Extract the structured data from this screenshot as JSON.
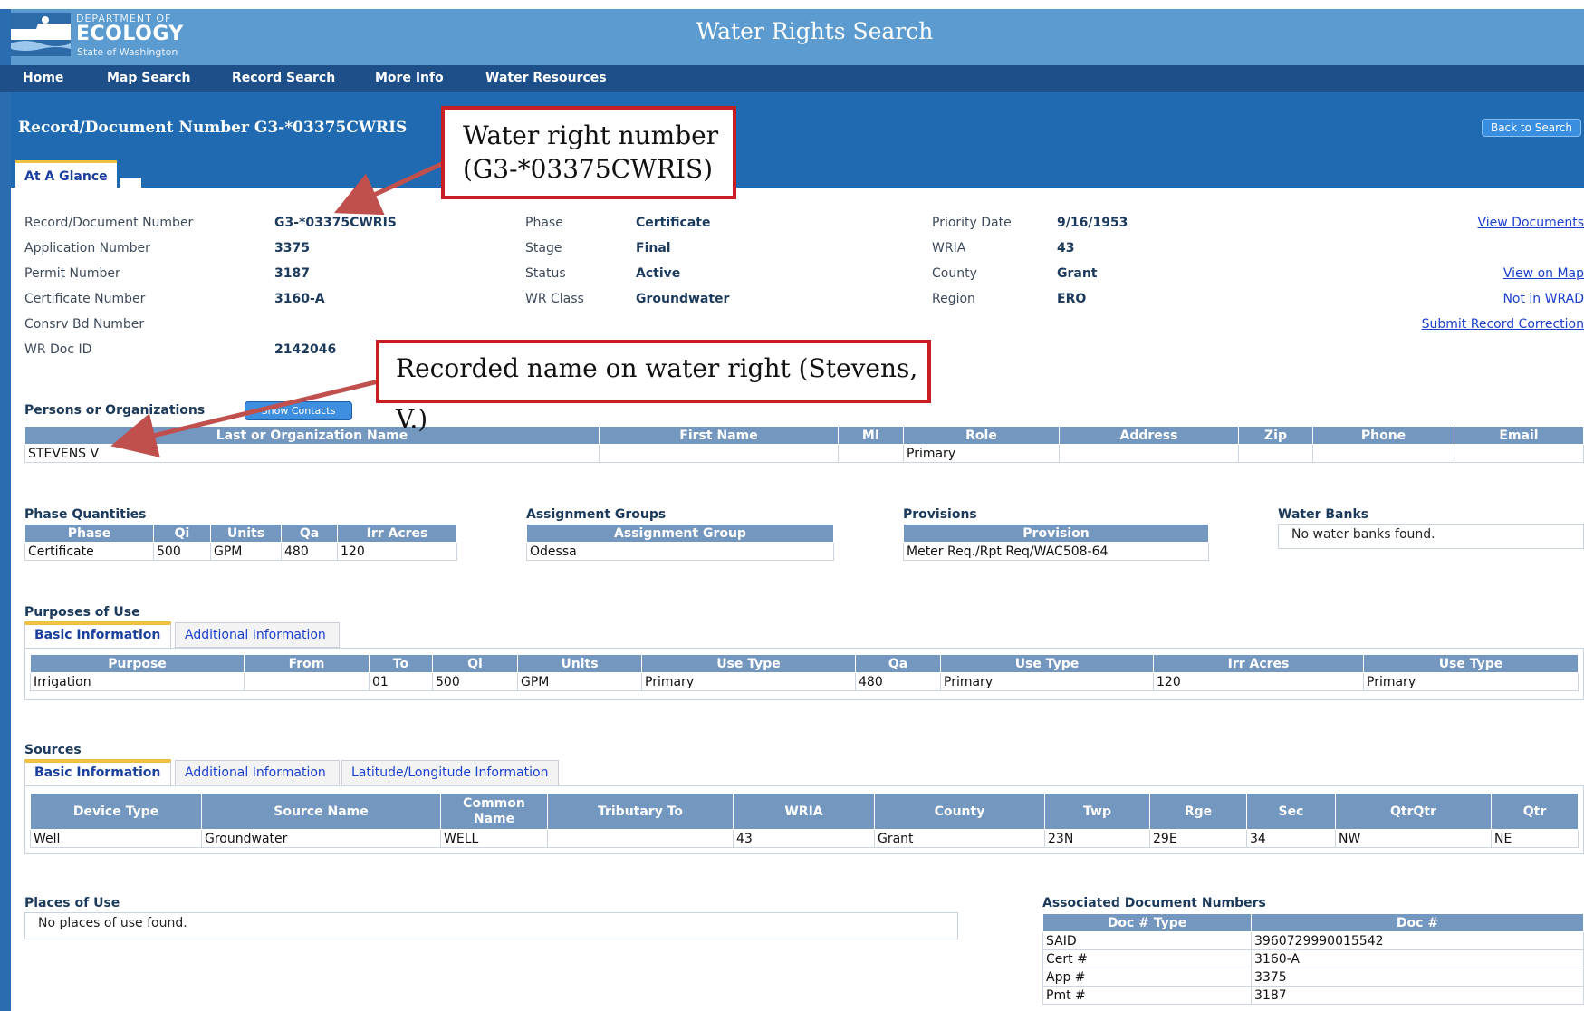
{
  "header": {
    "logo_line1": "DEPARTMENT OF",
    "logo_line2": "ECOLOGY",
    "logo_line3": "State of Washington",
    "title": "Water Rights Search"
  },
  "nav": [
    "Home",
    "Map Search",
    "Record Search",
    "More Info",
    "Water Resources"
  ],
  "record": {
    "title": "Record/Document Number G3-*03375CWRIS",
    "back_label": "Back to Search",
    "tab_label": "At A Glance"
  },
  "glance": {
    "col1": [
      [
        "Record/Document Number",
        "G3-*03375CWRIS"
      ],
      [
        "Application Number",
        "3375"
      ],
      [
        "Permit Number",
        "3187"
      ],
      [
        "Certificate Number",
        "3160-A"
      ],
      [
        "Consrv Bd Number",
        ""
      ],
      [
        "WR Doc ID",
        "2142046"
      ]
    ],
    "col2": [
      [
        "Phase",
        "Certificate"
      ],
      [
        "Stage",
        "Final"
      ],
      [
        "Status",
        "Active"
      ],
      [
        "WR Class",
        "Groundwater"
      ]
    ],
    "col3": [
      [
        "Priority Date",
        "9/16/1953"
      ],
      [
        "WRIA",
        "43"
      ],
      [
        "County",
        "Grant"
      ],
      [
        "Region",
        "ERO"
      ]
    ],
    "links": {
      "view_documents": "View Documents",
      "view_on_map": "View on Map",
      "not_in_wrad": "Not in WRAD",
      "submit_correction": "Submit Record Correction"
    }
  },
  "persons": {
    "title": "Persons or Organizations",
    "contacts_button": "Show Contacts",
    "headers": [
      "Last or Organization Name",
      "First Name",
      "MI",
      "Role",
      "Address",
      "Zip",
      "Phone",
      "Email"
    ],
    "rows": [
      [
        "STEVENS V",
        "",
        "",
        "Primary",
        "",
        "",
        "",
        ""
      ]
    ]
  },
  "phase_quantities": {
    "title": "Phase Quantities",
    "headers": [
      "Phase",
      "Qi",
      "Units",
      "Qa",
      "Irr Acres"
    ],
    "rows": [
      [
        "Certificate",
        "500",
        "GPM",
        "480",
        "120"
      ]
    ]
  },
  "assignment_groups": {
    "title": "Assignment Groups",
    "headers": [
      "Assignment Group"
    ],
    "rows": [
      [
        "Odessa"
      ]
    ]
  },
  "provisions": {
    "title": "Provisions",
    "headers": [
      "Provision"
    ],
    "rows": [
      [
        "Meter Req./Rpt Req/WAC508-64"
      ]
    ]
  },
  "water_banks": {
    "title": "Water Banks",
    "empty": "No water banks found."
  },
  "purposes": {
    "title": "Purposes of Use",
    "tabs": [
      "Basic Information",
      "Additional Information"
    ],
    "headers": [
      "Purpose",
      "From",
      "To",
      "Qi",
      "Units",
      "Use Type",
      "Qa",
      "Use Type",
      "Irr Acres",
      "Use Type"
    ],
    "rows": [
      [
        "Irrigation",
        "",
        "01",
        "500",
        "GPM",
        "Primary",
        "480",
        "Primary",
        "120",
        "Primary"
      ]
    ]
  },
  "sources": {
    "title": "Sources",
    "tabs": [
      "Basic Information",
      "Additional Information",
      "Latitude/Longitude Information"
    ],
    "headers": [
      "Device Type",
      "Source Name",
      "Common Name",
      "Tributary To",
      "WRIA",
      "County",
      "Twp",
      "Rge",
      "Sec",
      "QtrQtr",
      "Qtr"
    ],
    "rows": [
      [
        "Well",
        "Groundwater",
        "WELL",
        "",
        "43",
        "Grant",
        "23N",
        "29E",
        "34",
        "NW",
        "NE"
      ]
    ]
  },
  "places": {
    "title": "Places of Use",
    "empty": "No places of use found."
  },
  "assoc": {
    "title": "Associated Document Numbers",
    "headers": [
      "Doc # Type",
      "Doc #"
    ],
    "rows": [
      [
        "SAID",
        "3960729990015542"
      ],
      [
        "Cert #",
        "3160-A"
      ],
      [
        "App #",
        "3375"
      ],
      [
        "Pmt #",
        "3187"
      ]
    ]
  },
  "callouts": {
    "water_right": "Water right number\n(G3-*03375CWRIS)",
    "name": "Recorded name on water right (Stevens, V.)"
  },
  "colors": {
    "header": "#5b9bd0",
    "nav": "#1e4f89",
    "band": "#1f6ab0",
    "th": "#7497c0",
    "callout": "#c81e24"
  }
}
